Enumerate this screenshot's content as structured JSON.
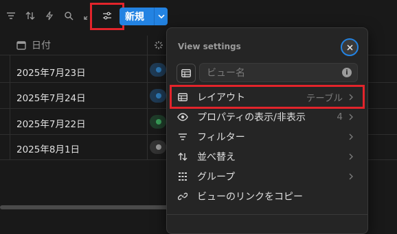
{
  "toolbar": {
    "icons": [
      "filter-icon",
      "sort-icon",
      "lightning-icon",
      "search-icon",
      "expand-icon",
      "settings-sliders-icon"
    ],
    "new_label": "新規"
  },
  "table": {
    "date_header": "日付",
    "rows": [
      {
        "date": "2025年7月23日",
        "status_color": "#2e7ab8"
      },
      {
        "date": "2025年7月24日",
        "status_color": "#2e7ab8"
      },
      {
        "date": "2025年7月22日",
        "status_color": "#3aa05a"
      },
      {
        "date": "2025年8月1日",
        "status_color": "#9b9b9b"
      }
    ]
  },
  "view_settings": {
    "title": "View settings",
    "name_placeholder": "ビュー名",
    "menu": [
      {
        "label": "レイアウト",
        "value": "テーブル",
        "icon": "table-icon"
      },
      {
        "label": "プロパティの表示/非表示",
        "value": "4",
        "icon": "eye-icon"
      },
      {
        "label": "フィルター",
        "value": "",
        "icon": "filter-icon"
      },
      {
        "label": "並べ替え",
        "value": "",
        "icon": "sort-icon"
      },
      {
        "label": "グループ",
        "value": "",
        "icon": "group-icon"
      },
      {
        "label": "ビューのリンクをコピー",
        "value": "",
        "icon": "link-icon"
      }
    ]
  },
  "colors": {
    "accent": "#2383e2",
    "highlight": "#e3242b",
    "background": "#191919",
    "panel": "#252525"
  }
}
